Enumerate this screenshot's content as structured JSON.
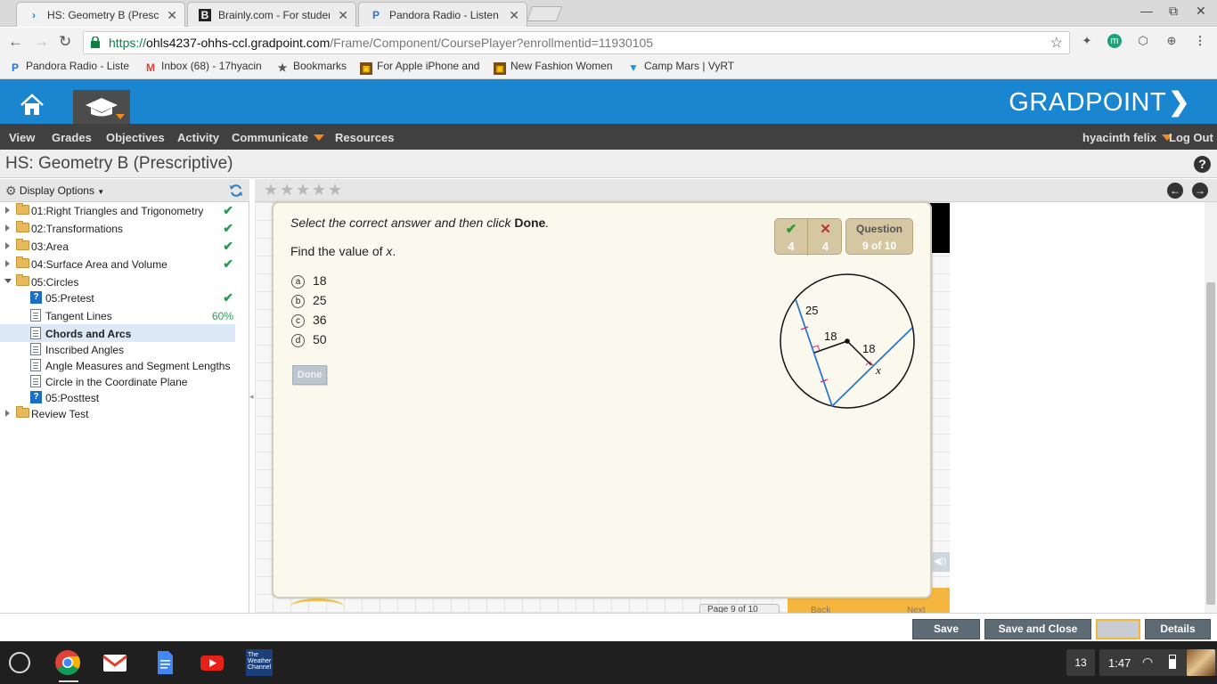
{
  "browser": {
    "tabs": [
      {
        "label": "HS: Geometry B (Prescrip",
        "favicon": "gradpoint-icon",
        "active": true
      },
      {
        "label": "Brainly.com - For studen",
        "favicon": "brainly-icon",
        "active": false
      },
      {
        "label": "Pandora Radio - Listen to",
        "favicon": "pandora-icon",
        "active": false
      }
    ],
    "url_host": "ohls4237-ohhs-ccl.gradpoint.com",
    "url_scheme": "https://",
    "url_path": "/Frame/Component/CoursePlayer?enrollmentid=11930105",
    "bookmarks": [
      {
        "label": "Pandora Radio - Liste",
        "icon": "pandora-icon"
      },
      {
        "label": "Inbox (68) - 17hyacin",
        "icon": "gmail-icon"
      },
      {
        "label": "Bookmarks",
        "icon": "star-icon"
      },
      {
        "label": "For Apple iPhone and",
        "icon": "shop-icon"
      },
      {
        "label": "New Fashion Women",
        "icon": "shop-icon"
      },
      {
        "label": "Camp Mars | VyRT",
        "icon": "vyrt-icon"
      }
    ]
  },
  "app": {
    "logo": "GRADPOINT",
    "nav": [
      "View",
      "Grades",
      "Objectives",
      "Activity",
      "Communicate",
      "Resources"
    ],
    "user": "hyacinth felix",
    "logout": "Log Out",
    "course_title": "HS: Geometry B (Prescriptive)",
    "help": "?"
  },
  "sidebar": {
    "display_options": "Display Options",
    "items": [
      {
        "label": "01:Right Triangles and Trigonometry",
        "status": "✔"
      },
      {
        "label": "02:Transformations",
        "status": "✔"
      },
      {
        "label": "03:Area",
        "status": "✔"
      },
      {
        "label": "04:Surface Area and Volume",
        "status": "✔"
      },
      {
        "label": "05:Circles",
        "status": ""
      },
      {
        "label": "05:Pretest",
        "status": "✔"
      },
      {
        "label": "Tangent Lines",
        "status": "60%"
      },
      {
        "label": "Chords and Arcs",
        "status": ""
      },
      {
        "label": "Inscribed Angles",
        "status": ""
      },
      {
        "label": "Angle Measures and Segment Lengths",
        "status": ""
      },
      {
        "label": "Circle in the Coordinate Plane",
        "status": ""
      },
      {
        "label": "05:Posttest",
        "status": ""
      },
      {
        "label": "Review Test",
        "status": ""
      }
    ]
  },
  "question": {
    "instruction_pre": "Select the correct answer and then click ",
    "instruction_bold": "Done",
    "instruction_post": ".",
    "prompt_pre": "Find the value of ",
    "prompt_var": "x",
    "prompt_post": ".",
    "choices": [
      {
        "letter": "a",
        "value": "18"
      },
      {
        "letter": "b",
        "value": "25"
      },
      {
        "letter": "c",
        "value": "36"
      },
      {
        "letter": "d",
        "value": "50"
      }
    ],
    "done_label": "Done",
    "correct_count": "4",
    "incorrect_count": "4",
    "question_label": "Question",
    "question_num": "9 of 10",
    "diagram_labels": {
      "chord_segment": "25",
      "left_distance": "18",
      "right_distance": "18",
      "unknown": "x"
    }
  },
  "bottom_partial": {
    "page_text": "Page  9  of 10",
    "back": "Back",
    "next": "Next"
  },
  "footer": {
    "save": "Save",
    "save_close": "Save and Close",
    "details": "Details"
  },
  "shelf": {
    "notifications": "13",
    "time": "1:47",
    "weather_label": "The Weather Channel"
  },
  "colors": {
    "brand_blue": "#1a86d0",
    "nav_dark": "#404040",
    "accent_orange": "#f28a1c",
    "check_green": "#2e9a57",
    "card_bg": "#fbf9ee"
  }
}
